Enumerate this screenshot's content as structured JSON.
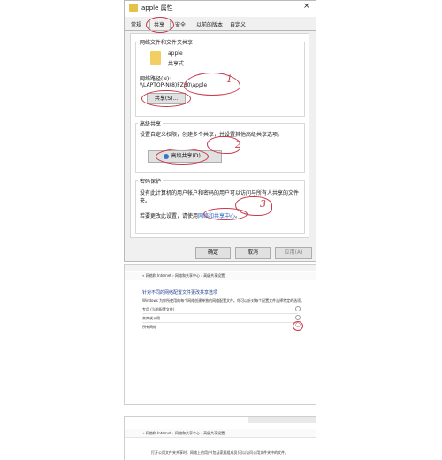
{
  "dialog": {
    "title": "apple 属性",
    "close": "×",
    "tabs": [
      "常规",
      "共享",
      "安全",
      "以前的版本",
      "自定义"
    ],
    "network_group_title": "网络文件和文件夹共享",
    "folder_name": "apple",
    "folder_status": "共享式",
    "network_path_label": "网络路径(N):",
    "network_path_value": "\\\\LAPTOP-N(8)FZ80\\apple",
    "share_button": "共享(S)...",
    "advanced_group_title": "高级共享",
    "advanced_desc": "设置自定义权限，创建多个共享，并设置其他高级共享选项。",
    "advanced_button": "高级共享(D)...",
    "password_group_title": "密码保护",
    "password_desc_1": "没有此计算机的用户帐户和密码的用户可以访问与所有人共享的文件",
    "password_desc_2": "夹。",
    "password_change_prefix": "若要更改此设置，请使用",
    "password_change_link": "网络和共享中心",
    "password_change_suffix": "。",
    "ok_button": "确定",
    "cancel_button": "取消",
    "apply_button": "应用(A)",
    "annotations": [
      "1",
      "2",
      "3"
    ]
  },
  "shot1": {
    "breadcrumb": "« 网络和 Internet › 网络和共享中心 › 高级共享设置",
    "heading": "针对不同的网络配置文件更改共享选项",
    "desc": "Windows 为你所使用的每个网络创建单独的网络配置文件。你可以针对每个配置文件选择特定的选项。",
    "rows": [
      "专用 (当前配置文件)",
      "来宾或公用",
      "所有网络"
    ],
    "annotation": "○"
  },
  "shot2": {
    "breadcrumb": "« 网络和 Internet › 网络和共享中心 › 高级共享设置",
    "desc": "打开公用文件夹共享时，网络上的用户(包括家庭组成员)可以访问公用文件夹中的文件。"
  }
}
